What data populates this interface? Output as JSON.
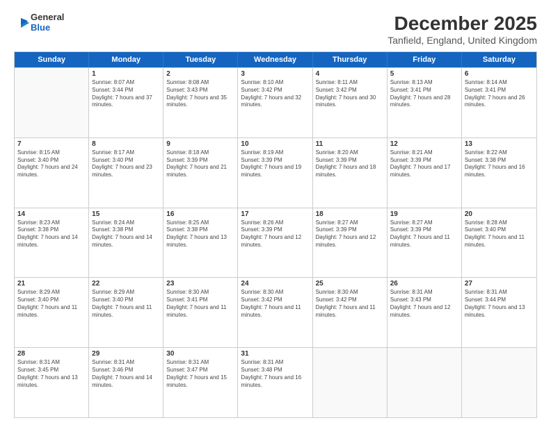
{
  "logo": {
    "line1": "General",
    "line2": "Blue"
  },
  "title": "December 2025",
  "subtitle": "Tanfield, England, United Kingdom",
  "days_of_week": [
    "Sunday",
    "Monday",
    "Tuesday",
    "Wednesday",
    "Thursday",
    "Friday",
    "Saturday"
  ],
  "weeks": [
    [
      {
        "day": "",
        "empty": true
      },
      {
        "day": "1",
        "sunrise": "8:07 AM",
        "sunset": "3:44 PM",
        "daylight": "7 hours and 37 minutes."
      },
      {
        "day": "2",
        "sunrise": "8:08 AM",
        "sunset": "3:43 PM",
        "daylight": "7 hours and 35 minutes."
      },
      {
        "day": "3",
        "sunrise": "8:10 AM",
        "sunset": "3:42 PM",
        "daylight": "7 hours and 32 minutes."
      },
      {
        "day": "4",
        "sunrise": "8:11 AM",
        "sunset": "3:42 PM",
        "daylight": "7 hours and 30 minutes."
      },
      {
        "day": "5",
        "sunrise": "8:13 AM",
        "sunset": "3:41 PM",
        "daylight": "7 hours and 28 minutes."
      },
      {
        "day": "6",
        "sunrise": "8:14 AM",
        "sunset": "3:41 PM",
        "daylight": "7 hours and 26 minutes."
      }
    ],
    [
      {
        "day": "7",
        "sunrise": "8:15 AM",
        "sunset": "3:40 PM",
        "daylight": "7 hours and 24 minutes."
      },
      {
        "day": "8",
        "sunrise": "8:17 AM",
        "sunset": "3:40 PM",
        "daylight": "7 hours and 23 minutes."
      },
      {
        "day": "9",
        "sunrise": "8:18 AM",
        "sunset": "3:39 PM",
        "daylight": "7 hours and 21 minutes."
      },
      {
        "day": "10",
        "sunrise": "8:19 AM",
        "sunset": "3:39 PM",
        "daylight": "7 hours and 19 minutes."
      },
      {
        "day": "11",
        "sunrise": "8:20 AM",
        "sunset": "3:39 PM",
        "daylight": "7 hours and 18 minutes."
      },
      {
        "day": "12",
        "sunrise": "8:21 AM",
        "sunset": "3:39 PM",
        "daylight": "7 hours and 17 minutes."
      },
      {
        "day": "13",
        "sunrise": "8:22 AM",
        "sunset": "3:38 PM",
        "daylight": "7 hours and 16 minutes."
      }
    ],
    [
      {
        "day": "14",
        "sunrise": "8:23 AM",
        "sunset": "3:38 PM",
        "daylight": "7 hours and 14 minutes."
      },
      {
        "day": "15",
        "sunrise": "8:24 AM",
        "sunset": "3:38 PM",
        "daylight": "7 hours and 14 minutes."
      },
      {
        "day": "16",
        "sunrise": "8:25 AM",
        "sunset": "3:38 PM",
        "daylight": "7 hours and 13 minutes."
      },
      {
        "day": "17",
        "sunrise": "8:26 AM",
        "sunset": "3:39 PM",
        "daylight": "7 hours and 12 minutes."
      },
      {
        "day": "18",
        "sunrise": "8:27 AM",
        "sunset": "3:39 PM",
        "daylight": "7 hours and 12 minutes."
      },
      {
        "day": "19",
        "sunrise": "8:27 AM",
        "sunset": "3:39 PM",
        "daylight": "7 hours and 11 minutes."
      },
      {
        "day": "20",
        "sunrise": "8:28 AM",
        "sunset": "3:40 PM",
        "daylight": "7 hours and 11 minutes."
      }
    ],
    [
      {
        "day": "21",
        "sunrise": "8:29 AM",
        "sunset": "3:40 PM",
        "daylight": "7 hours and 11 minutes."
      },
      {
        "day": "22",
        "sunrise": "8:29 AM",
        "sunset": "3:40 PM",
        "daylight": "7 hours and 11 minutes."
      },
      {
        "day": "23",
        "sunrise": "8:30 AM",
        "sunset": "3:41 PM",
        "daylight": "7 hours and 11 minutes."
      },
      {
        "day": "24",
        "sunrise": "8:30 AM",
        "sunset": "3:42 PM",
        "daylight": "7 hours and 11 minutes."
      },
      {
        "day": "25",
        "sunrise": "8:30 AM",
        "sunset": "3:42 PM",
        "daylight": "7 hours and 11 minutes."
      },
      {
        "day": "26",
        "sunrise": "8:31 AM",
        "sunset": "3:43 PM",
        "daylight": "7 hours and 12 minutes."
      },
      {
        "day": "27",
        "sunrise": "8:31 AM",
        "sunset": "3:44 PM",
        "daylight": "7 hours and 13 minutes."
      }
    ],
    [
      {
        "day": "28",
        "sunrise": "8:31 AM",
        "sunset": "3:45 PM",
        "daylight": "7 hours and 13 minutes."
      },
      {
        "day": "29",
        "sunrise": "8:31 AM",
        "sunset": "3:46 PM",
        "daylight": "7 hours and 14 minutes."
      },
      {
        "day": "30",
        "sunrise": "8:31 AM",
        "sunset": "3:47 PM",
        "daylight": "7 hours and 15 minutes."
      },
      {
        "day": "31",
        "sunrise": "8:31 AM",
        "sunset": "3:48 PM",
        "daylight": "7 hours and 16 minutes."
      },
      {
        "day": "",
        "empty": true
      },
      {
        "day": "",
        "empty": true
      },
      {
        "day": "",
        "empty": true
      }
    ]
  ]
}
